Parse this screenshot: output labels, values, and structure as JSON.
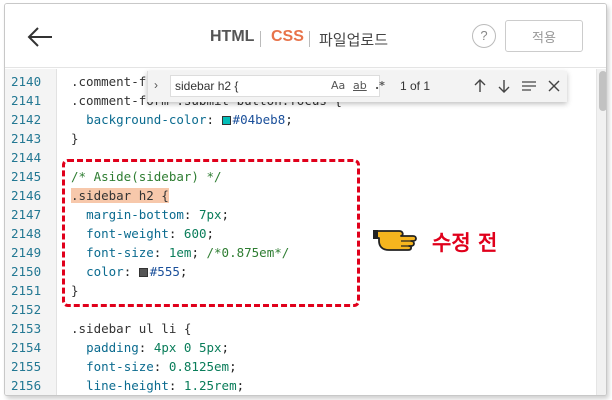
{
  "header": {
    "tabs": [
      {
        "label": "HTML"
      },
      {
        "label": "CSS"
      },
      {
        "label": "파일업로드"
      }
    ],
    "help_label": "?",
    "apply_label": "적용"
  },
  "find": {
    "query": "sidebar h2 {",
    "opt_case": "Aa",
    "opt_word": "ab",
    "opt_regex": ".*",
    "count": "1 of 1"
  },
  "editor": {
    "lines": [
      {
        "num": "2140",
        "text": ".comment-f"
      },
      {
        "num": "2141",
        "text": ".comment-form .submit-button:focus {"
      },
      {
        "num": "2142",
        "prop": "background-color",
        "value": "#04beb8",
        "swatch": "#04beb8"
      },
      {
        "num": "2143",
        "text": "}"
      },
      {
        "num": "2144",
        "text": ""
      },
      {
        "num": "2145",
        "comment": "/* Aside(sidebar) */"
      },
      {
        "num": "2146",
        "highlight": ".sidebar h2 {"
      },
      {
        "num": "2147",
        "prop": "margin-bottom",
        "value": "7px"
      },
      {
        "num": "2148",
        "prop": "font-weight",
        "value": "600"
      },
      {
        "num": "2149",
        "prop": "font-size",
        "value": "1em",
        "comment": "/*0.875em*/"
      },
      {
        "num": "2150",
        "prop": "color",
        "value": "#555",
        "swatch": "#555555"
      },
      {
        "num": "2151",
        "text": "}"
      },
      {
        "num": "2152",
        "text": ""
      },
      {
        "num": "2153",
        "text": ".sidebar ul li {"
      },
      {
        "num": "2154",
        "prop": "padding",
        "value": "4px 0 5px"
      },
      {
        "num": "2155",
        "prop": "font-size",
        "value": "0.8125em"
      },
      {
        "num": "2156",
        "prop": "line-height",
        "value": "1.25rem"
      }
    ]
  },
  "annotation": {
    "label": "수정 전",
    "color": "#e0001b"
  }
}
